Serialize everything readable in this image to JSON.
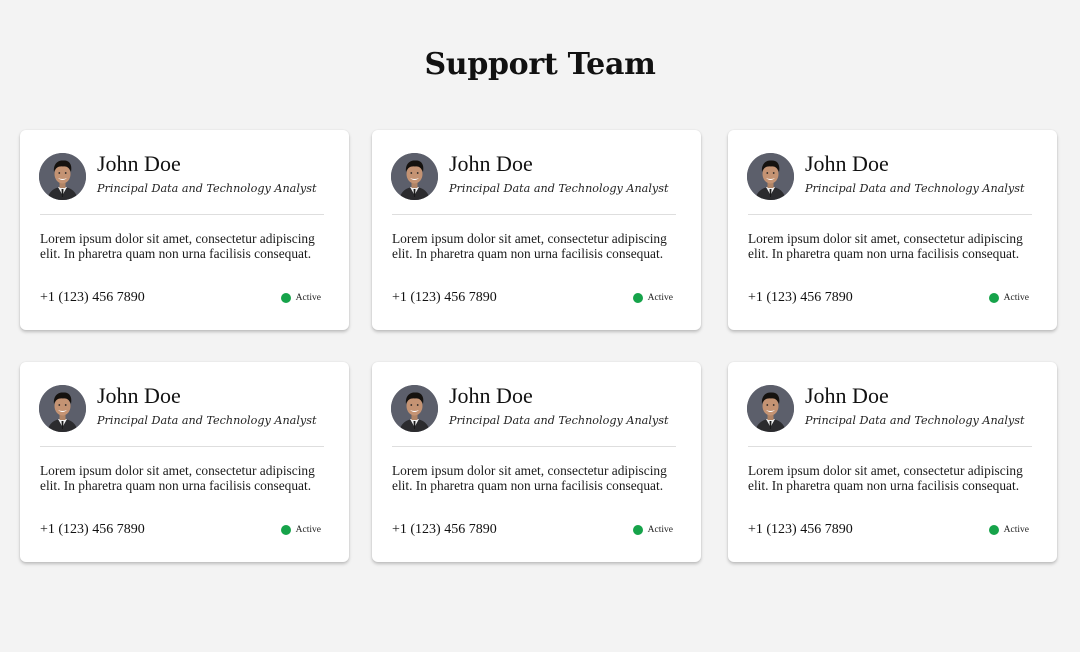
{
  "page": {
    "title": "Support Team"
  },
  "colors": {
    "background": "#f3f3f3",
    "card": "#ffffff",
    "active": "#16a34a"
  },
  "cards": [
    {
      "name": "John Doe",
      "role": "Principal Data and Technology Analyst",
      "description": "Lorem ipsum dolor sit amet, consectetur adipiscing elit. In pharetra quam non urna facilisis consequat.",
      "phone": "+1 (123) 456 7890",
      "status": "Active",
      "avatar_icon": "person-photo-avatar"
    },
    {
      "name": "John Doe",
      "role": "Principal Data and Technology Analyst",
      "description": "Lorem ipsum dolor sit amet, consectetur adipiscing elit. In pharetra quam non urna facilisis consequat.",
      "phone": "+1 (123) 456 7890",
      "status": "Active",
      "avatar_icon": "person-photo-avatar"
    },
    {
      "name": "John Doe",
      "role": "Principal Data and Technology Analyst",
      "description": "Lorem ipsum dolor sit amet, consectetur adipiscing elit. In pharetra quam non urna facilisis consequat.",
      "phone": "+1 (123) 456 7890",
      "status": "Active",
      "avatar_icon": "person-photo-avatar"
    },
    {
      "name": "John Doe",
      "role": "Principal Data and Technology Analyst",
      "description": "Lorem ipsum dolor sit amet, consectetur adipiscing elit. In pharetra quam non urna facilisis consequat.",
      "phone": "+1 (123) 456 7890",
      "status": "Active",
      "avatar_icon": "person-photo-avatar"
    },
    {
      "name": "John Doe",
      "role": "Principal Data and Technology Analyst",
      "description": "Lorem ipsum dolor sit amet, consectetur adipiscing elit. In pharetra quam non urna facilisis consequat.",
      "phone": "+1 (123) 456 7890",
      "status": "Active",
      "avatar_icon": "person-photo-avatar"
    },
    {
      "name": "John Doe",
      "role": "Principal Data and Technology Analyst",
      "description": "Lorem ipsum dolor sit amet, consectetur adipiscing elit. In pharetra quam non urna facilisis consequat.",
      "phone": "+1 (123) 456 7890",
      "status": "Active",
      "avatar_icon": "person-photo-avatar"
    }
  ]
}
